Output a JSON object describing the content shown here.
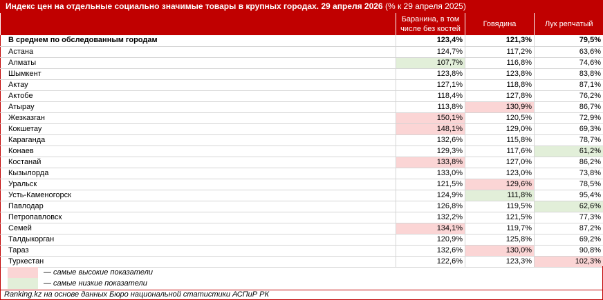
{
  "title": {
    "main": "Индекс цен на отдельные социально значимые товары в крупных городах. 29 апреля 2026",
    "sub": " (% к 29 апреля 2025)"
  },
  "columns": [
    "",
    "Баранина, в том числе без костей",
    "Говядина",
    "Лук репчатый"
  ],
  "average_row": {
    "city": "В среднем по обследованным городам",
    "values": [
      "123,4%",
      "121,3%",
      "79,5%"
    ]
  },
  "rows": [
    {
      "city": "Астана",
      "values": [
        "124,7%",
        "117,2%",
        "63,6%"
      ],
      "marks": [
        "",
        "",
        ""
      ]
    },
    {
      "city": "Алматы",
      "values": [
        "107,7%",
        "116,8%",
        "74,6%"
      ],
      "marks": [
        "low",
        "",
        ""
      ]
    },
    {
      "city": "Шымкент",
      "values": [
        "123,8%",
        "123,8%",
        "83,8%"
      ],
      "marks": [
        "",
        "",
        ""
      ]
    },
    {
      "city": "Актау",
      "values": [
        "127,1%",
        "118,8%",
        "87,1%"
      ],
      "marks": [
        "",
        "",
        ""
      ]
    },
    {
      "city": "Актобе",
      "values": [
        "118,4%",
        "127,8%",
        "76,2%"
      ],
      "marks": [
        "",
        "",
        ""
      ]
    },
    {
      "city": "Атырау",
      "values": [
        "113,8%",
        "130,9%",
        "86,7%"
      ],
      "marks": [
        "",
        "high",
        ""
      ]
    },
    {
      "city": "Жезказган",
      "values": [
        "150,1%",
        "120,5%",
        "72,9%"
      ],
      "marks": [
        "high",
        "",
        ""
      ]
    },
    {
      "city": "Кокшетау",
      "values": [
        "148,1%",
        "129,0%",
        "69,3%"
      ],
      "marks": [
        "high",
        "",
        ""
      ]
    },
    {
      "city": "Караганда",
      "values": [
        "132,6%",
        "115,8%",
        "78,7%"
      ],
      "marks": [
        "",
        "",
        ""
      ]
    },
    {
      "city": "Конаев",
      "values": [
        "129,3%",
        "117,6%",
        "61,2%"
      ],
      "marks": [
        "",
        "",
        "low"
      ]
    },
    {
      "city": "Костанай",
      "values": [
        "133,8%",
        "127,0%",
        "86,2%"
      ],
      "marks": [
        "high",
        "",
        ""
      ]
    },
    {
      "city": "Кызылорда",
      "values": [
        "133,0%",
        "123,0%",
        "73,8%"
      ],
      "marks": [
        "",
        "",
        ""
      ]
    },
    {
      "city": "Уральск",
      "values": [
        "121,5%",
        "129,6%",
        "78,5%"
      ],
      "marks": [
        "",
        "high",
        ""
      ]
    },
    {
      "city": "Усть-Каменогорск",
      "values": [
        "124,9%",
        "111,8%",
        "95,4%"
      ],
      "marks": [
        "",
        "low",
        ""
      ]
    },
    {
      "city": "Павлодар",
      "values": [
        "126,8%",
        "119,5%",
        "62,6%"
      ],
      "marks": [
        "",
        "",
        "low"
      ]
    },
    {
      "city": "Петропавловск",
      "values": [
        "132,2%",
        "121,5%",
        "77,3%"
      ],
      "marks": [
        "",
        "",
        ""
      ]
    },
    {
      "city": "Семей",
      "values": [
        "134,1%",
        "119,7%",
        "87,2%"
      ],
      "marks": [
        "high",
        "",
        ""
      ]
    },
    {
      "city": "Талдыкорган",
      "values": [
        "120,9%",
        "125,8%",
        "69,2%"
      ],
      "marks": [
        "",
        "",
        ""
      ]
    },
    {
      "city": "Тараз",
      "values": [
        "132,6%",
        "130,0%",
        "90,8%"
      ],
      "marks": [
        "",
        "high",
        ""
      ]
    },
    {
      "city": "Туркестан",
      "values": [
        "122,6%",
        "123,3%",
        "102,3%"
      ],
      "marks": [
        "",
        "",
        "high"
      ]
    }
  ],
  "legend": {
    "high": "— самые высокие показатели",
    "low": "— самые низкие показатели"
  },
  "colors": {
    "header": "#c00000",
    "high": "#fbd5d5",
    "low": "#e2efd9"
  },
  "source": "Ranking.kz на основе данных Бюро национальной статистики АСПиР РК"
}
